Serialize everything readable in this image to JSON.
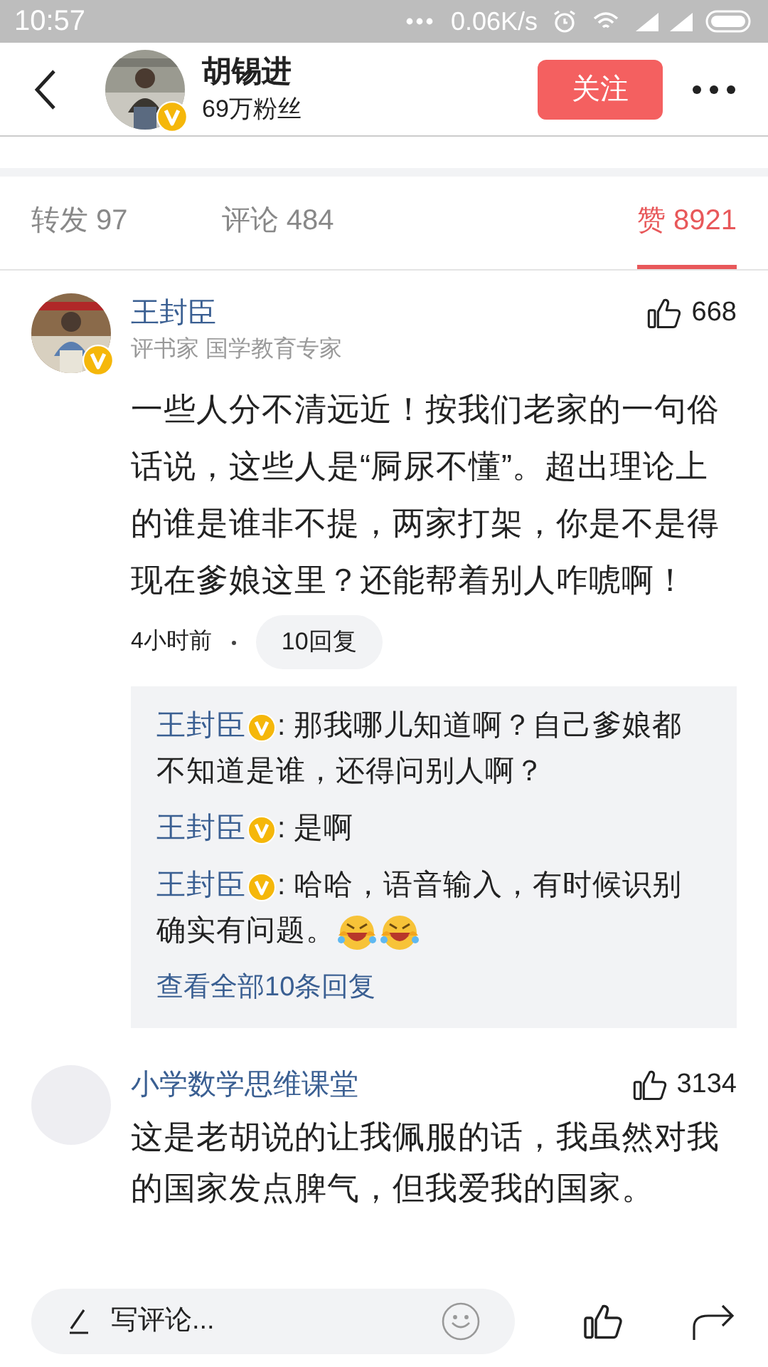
{
  "status_bar": {
    "time": "10:57",
    "speed": "0.06K/s"
  },
  "header": {
    "name": "胡锡进",
    "fans": "69万粉丝",
    "verified": true,
    "follow": "关注"
  },
  "tabs": [
    {
      "label": "转发 97",
      "selected": false
    },
    {
      "label": "评论 484",
      "selected": false
    },
    {
      "label": "赞 8921",
      "selected": true
    }
  ],
  "comments": [
    {
      "name": "王封臣",
      "verified": true,
      "subtitle": "评书家 国学教育专家",
      "likes": "668",
      "text": "一些人分不清远近！按我们老家的一句俗话说，这些人是“屙尿不懂”。超出理论上的谁是谁非不提，两家打架，你是不是得现在爹娘这里？还能帮着别人咋唬啊！",
      "time": "4小时前",
      "reply_count": "10回复",
      "replies": [
        {
          "name": "王封臣",
          "verified": true,
          "text": ": 那我哪儿知道啊？自己爹娘都不知道是谁，还得问别人啊？"
        },
        {
          "name": "王封臣",
          "verified": true,
          "text": ": 是啊"
        },
        {
          "name": "王封臣",
          "verified": true,
          "text": ": 哈哈，语音输入，有时候识别确实有问题。",
          "emojis": [
            {
              "kind": "laugh"
            },
            {
              "kind": "laugh"
            }
          ]
        }
      ],
      "more": "查看全部10条回复"
    },
    {
      "name": "小学数学思维课堂",
      "likes": "3134",
      "text": "这是老胡说的让我佩服的话，我虽然对我的国家发点脾气，但我爱我的国家。"
    }
  ],
  "composer": {
    "placeholder": "写评论..."
  }
}
